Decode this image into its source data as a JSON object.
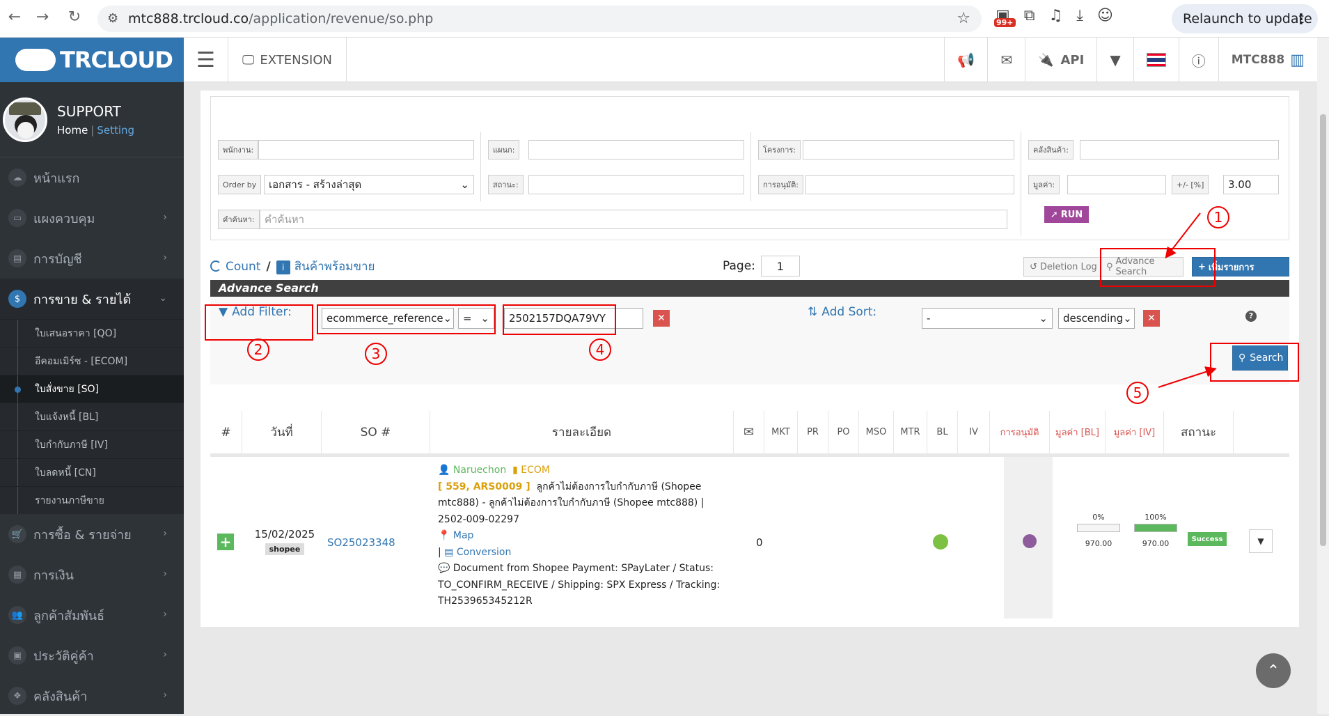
{
  "browser": {
    "url_host": "mtc888.trcloud.co",
    "url_path": "/application/revenue/so.php",
    "ext_badge": "99+",
    "relaunch_label": "Relaunch to update"
  },
  "brand": {
    "logo_text": "TRCLOUD"
  },
  "profile": {
    "name": "SUPPORT",
    "home": "Home",
    "setting": "Setting"
  },
  "sidebar": {
    "items": [
      {
        "label": "หน้าแรก",
        "icon": "cloud-icon"
      },
      {
        "label": "แผงควบคุม",
        "icon": "monitor-icon"
      },
      {
        "label": "การบัญชี",
        "icon": "book-icon"
      },
      {
        "label": "การขาย & รายได้",
        "icon": "dollar-icon"
      },
      {
        "label": "การซื้อ & รายจ่าย",
        "icon": "cart-icon"
      },
      {
        "label": "การเงิน",
        "icon": "calendar-icon"
      },
      {
        "label": "ลูกค้าสัมพันธ์",
        "icon": "users-icon"
      },
      {
        "label": "ประวัติคู่ค้า",
        "icon": "contact-icon"
      },
      {
        "label": "คลังสินค้า",
        "icon": "cubes-icon"
      }
    ],
    "sub": [
      "ใบเสนอราคา [QO]",
      "อีคอมเมิร์ซ - [ECOM]",
      "ใบสั่งขาย [SO]",
      "ใบแจ้งหนี้ [BL]",
      "ใบกำกับภาษี [IV]",
      "ใบลดหนี้ [CN]",
      "รายงานภาษีขาย"
    ]
  },
  "topbar": {
    "extension": "EXTENSION",
    "api": "API",
    "user": "MTC888"
  },
  "filters": {
    "employee": "พนักงาน:",
    "department": "แผนก:",
    "project": "โครงการ:",
    "warehouse": "คลังสินค้า:",
    "orderby_label": "Order by",
    "orderby_value": "เอกสาร - สร้างล่าสุด",
    "status": "สถานะ:",
    "approval": "การอนุมัติ:",
    "value": "มูลค่า:",
    "tolerance_label": "+/- [%]",
    "tolerance_value": "3.00",
    "keyword_label": "คำค้นหา:",
    "keyword_placeholder": "คำค้นหา",
    "run": "RUN"
  },
  "toolbar": {
    "count": "Count",
    "slash": "/",
    "ready": "สินค้าพร้อมขาย",
    "page_label": "Page:",
    "page_value": "1",
    "deletion_log": "Deletion Log",
    "advance_search": "Advance Search",
    "add_item": "เพิ่มรายการ"
  },
  "advance": {
    "title": "Advance Search",
    "add_filter": "Add Filter:",
    "field": "ecommerce_reference",
    "operator": "=",
    "value": "2502157DQA79VY",
    "add_sort": "Add Sort:",
    "sort_field": "-",
    "sort_dir": "descending",
    "search": "Search",
    "help": "?"
  },
  "annotations": [
    "1",
    "2",
    "3",
    "4",
    "5"
  ],
  "table": {
    "headers": [
      "#",
      "วันที่",
      "SO #",
      "รายละเอียด",
      "",
      "MKT",
      "PR",
      "PO",
      "MSO",
      "MTR",
      "BL",
      "IV",
      "การอนุมัติ",
      "มูลค่า [BL]",
      "มูลค่า [IV]",
      "สถานะ"
    ],
    "row": {
      "date": "15/02/2025",
      "channel": "shopee",
      "so_no": "SO25023348",
      "salesperson": "Naruechon",
      "tag": "ECOM",
      "ref": "[ 559, ARS0009 ]",
      "desc1": "ลูกค้าไม่ต้องการใบกำกับภาษี (Shopee mtc888) - ลูกค้าไม่ต้องการใบกำกับภาษี (Shopee mtc888) | 2502-009-02297",
      "map": "Map",
      "conversion": "Conversion",
      "doc_note": "Document from Shopee Payment: SPayLater / Status: TO_CONFIRM_RECEIVE / Shipping: SPX Express / Tracking: TH253965345212R",
      "mail_count": "0",
      "bl_pct_label": "0%",
      "bl_pct": 0,
      "bl_value": "970.00",
      "iv_pct_label": "100%",
      "iv_pct": 100,
      "iv_value": "970.00",
      "status": "Success"
    }
  },
  "colors": {
    "brand": "#3276b1",
    "sidebar": "#2e3338",
    "success": "#5cb85c",
    "danger": "#d9534f",
    "run": "#a0479b",
    "annotation": "#ee0000"
  }
}
